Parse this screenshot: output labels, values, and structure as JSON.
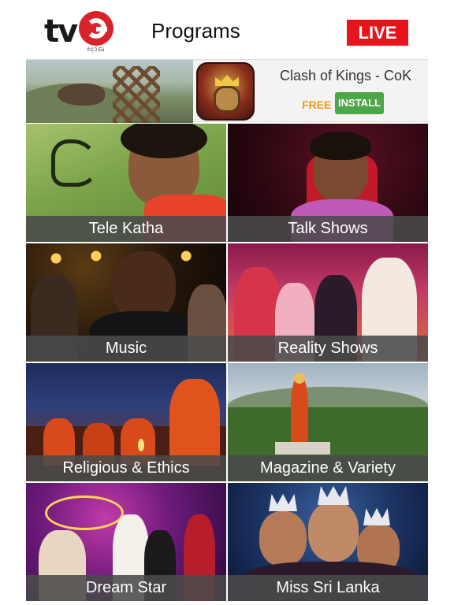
{
  "header": {
    "logo_text": "tv",
    "logo_subtext": "දෙරණ",
    "title": "Programs",
    "live_label": "LIVE"
  },
  "ad": {
    "app_name": "Clash of Kings - CoK",
    "price_label": "FREE",
    "install_label": "INSTALL"
  },
  "programs": [
    {
      "label": "Tele Katha"
    },
    {
      "label": "Talk Shows"
    },
    {
      "label": "Music"
    },
    {
      "label": "Reality Shows"
    },
    {
      "label": "Religious & Ethics"
    },
    {
      "label": "Magazine & Variety"
    },
    {
      "label": "Dream Star"
    },
    {
      "label": "Miss Sri Lanka"
    }
  ],
  "colors": {
    "live_red": "#e8141c",
    "logo_red": "#d8232a",
    "free_orange": "#f39a1e",
    "install_green": "#4ea64a",
    "label_overlay": "#4a4a4a"
  }
}
